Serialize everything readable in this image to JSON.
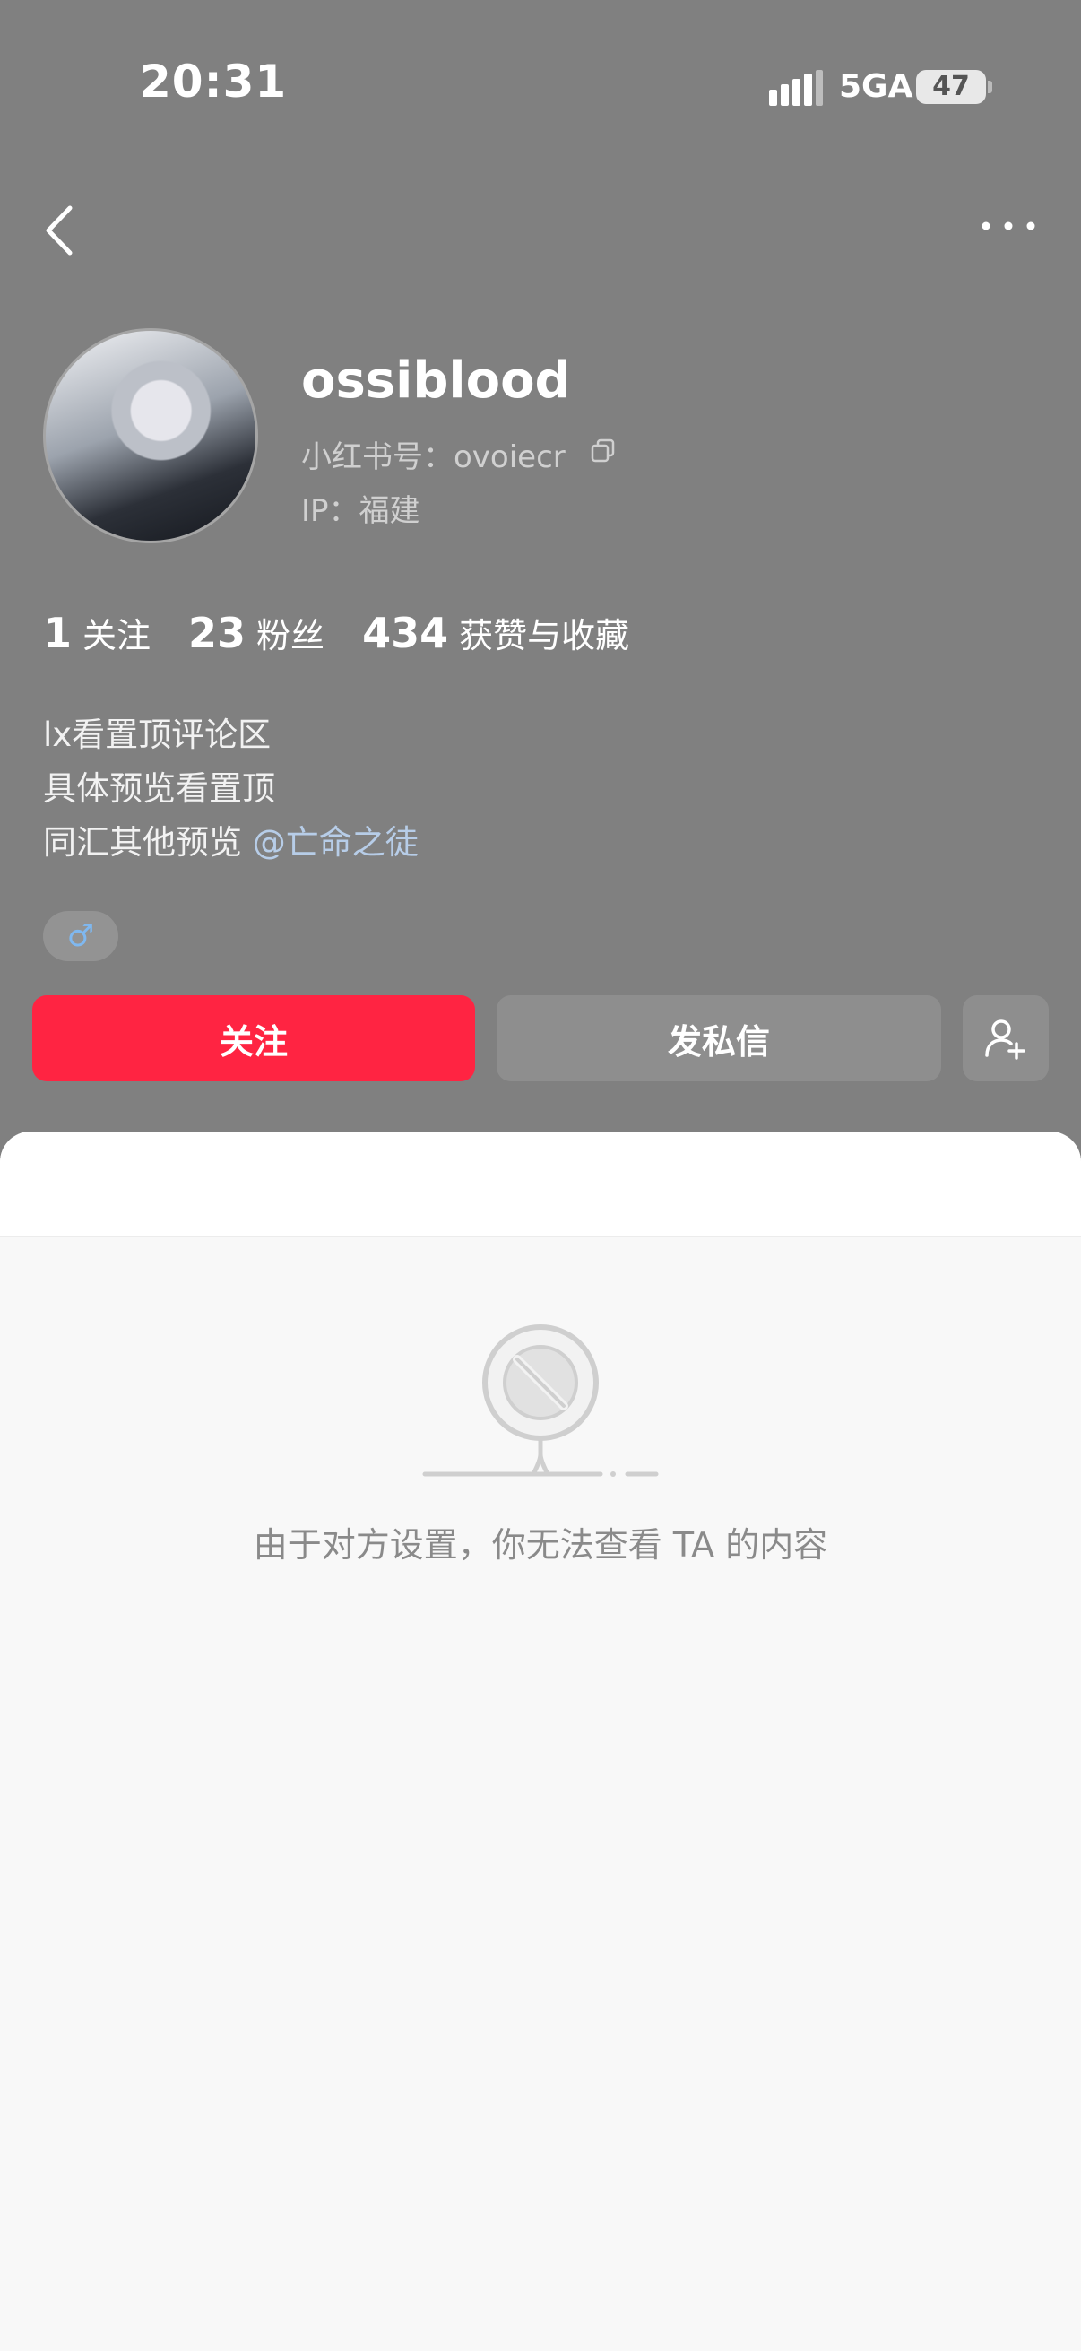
{
  "status_bar": {
    "time": "20:31",
    "network": "5GA",
    "battery": "47"
  },
  "nav": {
    "back_icon": "chevron-left-icon",
    "more_icon": "more-horizontal-icon"
  },
  "profile": {
    "username": "ossiblood",
    "redbook_id": "小红书号：ovoiecr",
    "ip": "IP：福建",
    "stats": [
      {
        "num": "1",
        "label": "关注"
      },
      {
        "num": "23",
        "label": "粉丝"
      },
      {
        "num": "434",
        "label": "获赞与收藏"
      }
    ],
    "bio": {
      "line1": "lx看置顶评论区",
      "line2": "具体预览看置顶",
      "line3_prefix": "同汇其他预览 ",
      "line3_mention": "@亡命之徒"
    },
    "gender": "♂"
  },
  "actions": {
    "follow": "关注",
    "message": "发私信",
    "add_friend_icon": "add-user-icon"
  },
  "content": {
    "empty_text": "由于对方设置，你无法查看 TA 的内容"
  },
  "colors": {
    "header_bg": "#808080",
    "accent": "#ff2442",
    "mention": "#b7cde8",
    "gender": "#7fb8f0"
  }
}
